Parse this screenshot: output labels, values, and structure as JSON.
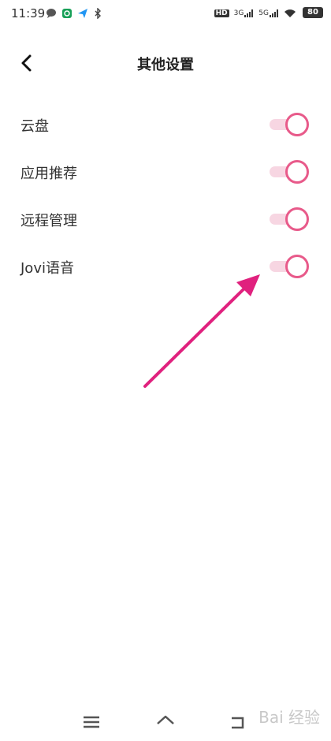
{
  "status_bar": {
    "time": "11:39",
    "net_labels": [
      "HD",
      "3G",
      "5G"
    ],
    "battery": "80"
  },
  "header": {
    "title": "其他设置",
    "back_icon": "chevron-left-icon"
  },
  "settings": [
    {
      "label": "云盘",
      "enabled": true
    },
    {
      "label": "应用推荐",
      "enabled": true
    },
    {
      "label": "远程管理",
      "enabled": true
    },
    {
      "label": "Jovi语音",
      "enabled": true
    }
  ],
  "annotation": {
    "color": "#e0217e"
  },
  "nav_bar": {
    "icons": [
      "menu-icon",
      "home-icon",
      "back-icon"
    ]
  },
  "watermark": "Bai 经验",
  "colors": {
    "accent": "#e85a8a",
    "track": "#f7d6e2"
  }
}
